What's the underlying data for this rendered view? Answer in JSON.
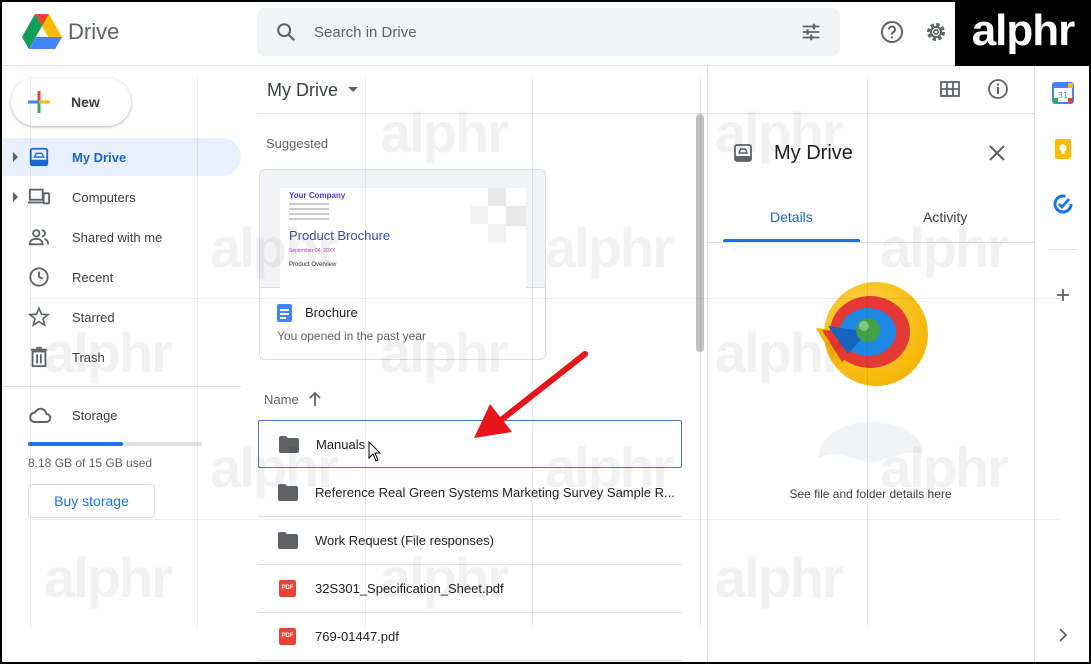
{
  "app": {
    "name": "Drive"
  },
  "search": {
    "placeholder": "Search in Drive"
  },
  "header_icons": [
    "search-icon",
    "tune-icon",
    "help-icon",
    "settings-icon"
  ],
  "watermark_badge": "alphr",
  "sidebar": {
    "new_label": "New",
    "items": [
      {
        "label": "My Drive",
        "icon": "my-drive-icon",
        "active": true,
        "expandable": true
      },
      {
        "label": "Computers",
        "icon": "computers-icon",
        "active": false,
        "expandable": true
      },
      {
        "label": "Shared with me",
        "icon": "shared-icon",
        "active": false,
        "expandable": false
      },
      {
        "label": "Recent",
        "icon": "clock-icon",
        "active": false,
        "expandable": false
      },
      {
        "label": "Starred",
        "icon": "star-icon",
        "active": false,
        "expandable": false
      },
      {
        "label": "Trash",
        "icon": "trash-icon",
        "active": false,
        "expandable": false
      }
    ],
    "storage": {
      "label": "Storage",
      "used_text": "8.18 GB of 15 GB used",
      "used_fraction": 0.545,
      "buy_label": "Buy storage"
    }
  },
  "main": {
    "title": "My Drive",
    "suggested_label": "Suggested",
    "suggested_card": {
      "name": "Brochure",
      "subtitle": "You opened in the past year",
      "thumb": {
        "company": "Your Company",
        "title": "Product Brochure",
        "date": "September 04, 20XX",
        "overview": "Product Overview"
      }
    },
    "list_header": "Name",
    "files": [
      {
        "name": "Manuals",
        "type": "folder",
        "selected": true
      },
      {
        "name": "Reference Real Green Systems Marketing Survey Sample R...",
        "type": "folder",
        "selected": false
      },
      {
        "name": "Work Request (File responses)",
        "type": "folder",
        "selected": false
      },
      {
        "name": "32S301_Specification_Sheet.pdf",
        "type": "pdf",
        "selected": false
      },
      {
        "name": "769-01447.pdf",
        "type": "pdf",
        "selected": false
      }
    ],
    "pdf_badge": "PDF"
  },
  "details_panel": {
    "title": "My Drive",
    "tabs": [
      {
        "label": "Details",
        "active": true
      },
      {
        "label": "Activity",
        "active": false
      }
    ],
    "hint": "See file and folder details here"
  },
  "colors": {
    "accent": "#1a73e8",
    "active_bg": "#e8f0fe",
    "arrow": "#e8141b",
    "pdf": "#ea4335"
  }
}
